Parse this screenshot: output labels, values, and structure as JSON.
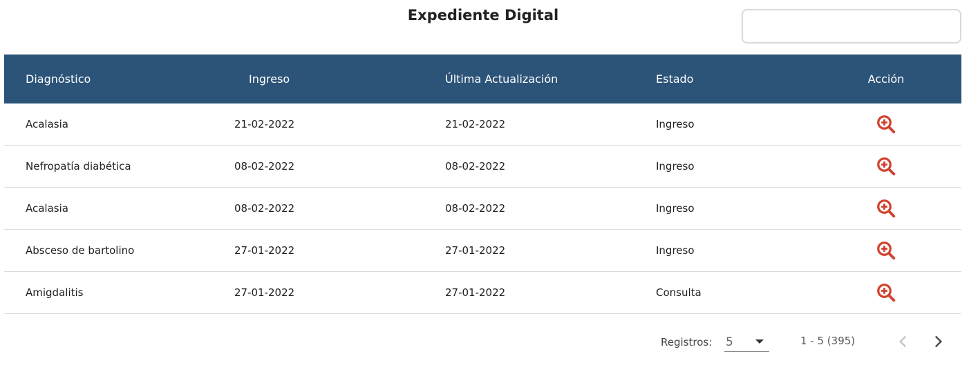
{
  "page": {
    "title": "Expediente Digital"
  },
  "search": {
    "value": "",
    "placeholder": ""
  },
  "table": {
    "headers": {
      "diagnostico": "Diagnóstico",
      "ingreso": "Ingreso",
      "ultima": "Última Actualización",
      "estado": "Estado",
      "accion": "Acción"
    },
    "rows": [
      {
        "diagnostico": "Acalasia",
        "ingreso": "21-02-2022",
        "ultima": "21-02-2022",
        "estado": "Ingreso",
        "accion_icon": "zoom-in-icon"
      },
      {
        "diagnostico": "Nefropatía diabética",
        "ingreso": "08-02-2022",
        "ultima": "08-02-2022",
        "estado": "Ingreso",
        "accion_icon": "zoom-in-icon"
      },
      {
        "diagnostico": "Acalasia",
        "ingreso": "08-02-2022",
        "ultima": "08-02-2022",
        "estado": "Ingreso",
        "accion_icon": "zoom-in-icon"
      },
      {
        "diagnostico": "Absceso de bartolino",
        "ingreso": "27-01-2022",
        "ultima": "27-01-2022",
        "estado": "Ingreso",
        "accion_icon": "zoom-in-icon"
      },
      {
        "diagnostico": "Amigdalitis",
        "ingreso": "27-01-2022",
        "ultima": "27-01-2022",
        "estado": "Consulta",
        "accion_icon": "zoom-in-icon"
      }
    ]
  },
  "pagination": {
    "registros_label": "Registros:",
    "page_size": "5",
    "range": "1 - 5 (395)",
    "prev_icon": "chevron-left-icon",
    "next_icon": "chevron-right-icon"
  },
  "colors": {
    "header_bg": "#2c5378",
    "action_icon": "#d0432f",
    "row_divider": "#dcdcdc"
  }
}
